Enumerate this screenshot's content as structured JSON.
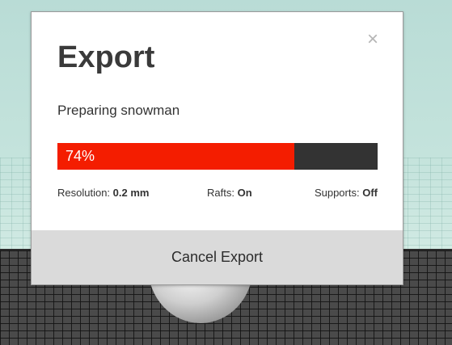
{
  "dialog": {
    "title": "Export",
    "close_glyph": "×",
    "status_text": "Preparing snowman",
    "progress": {
      "percent": 74,
      "label": "74%",
      "fill_color": "#f41d00",
      "track_color": "#333333"
    },
    "settings": {
      "resolution": {
        "label": "Resolution:",
        "value": "0.2 mm"
      },
      "rafts": {
        "label": "Rafts:",
        "value": "On"
      },
      "supports": {
        "label": "Supports:",
        "value": "Off"
      }
    },
    "cancel_label": "Cancel Export"
  },
  "icons": {
    "close": "close-icon"
  },
  "colors": {
    "background": "#c4e3dc",
    "bed": "#4a4a4a",
    "footer": "#dadada"
  }
}
